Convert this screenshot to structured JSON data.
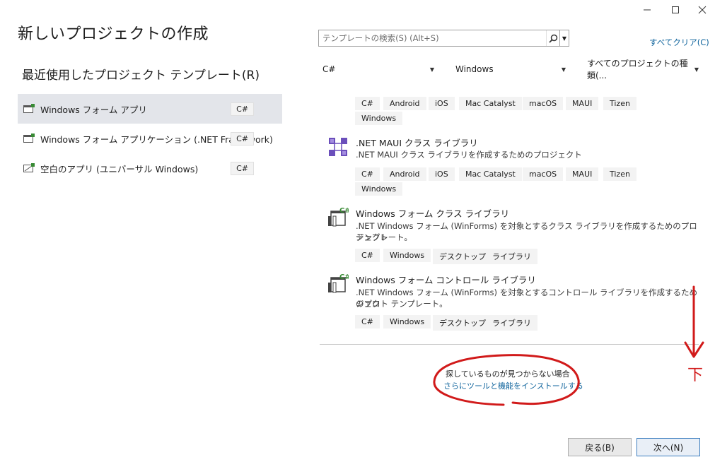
{
  "window": {
    "title": "新しいプロジェクトの作成",
    "controls": [
      "minimize-icon",
      "maximize-icon",
      "close-icon"
    ]
  },
  "recent": {
    "title": "最近使用したプロジェクト テンプレート(R)",
    "items": [
      {
        "label": "Windows フォーム アプリ",
        "lang": "C#",
        "icon": "winforms-app-icon",
        "selected": true
      },
      {
        "label": "Windows フォーム アプリケーション (.NET Framework)",
        "lang": "C#",
        "icon": "winforms-app-icon",
        "selected": false
      },
      {
        "label": "空白のアプリ (ユニバーサル Windows)",
        "lang": "C#",
        "icon": "uwp-app-icon",
        "selected": false
      }
    ]
  },
  "search": {
    "placeholder": "テンプレートの検索(S) (Alt+S)",
    "clear_all": "すべてクリア(C)"
  },
  "filters": {
    "language": "C#",
    "platform": "Windows",
    "project_type": "すべてのプロジェクトの種類(..."
  },
  "templates": [
    {
      "name": "",
      "desc": "",
      "tags": [
        "C#",
        "Android",
        "iOS",
        "Mac Catalyst",
        "macOS",
        "MAUI",
        "Tizen",
        "Windows"
      ]
    },
    {
      "name": ".NET MAUI クラス ライブラリ",
      "desc": ".NET MAUI クラス ライブラリを作成するためのプロジェクト",
      "icon": "maui-class-library-icon",
      "tags": [
        "C#",
        "Android",
        "iOS",
        "Mac Catalyst",
        "macOS",
        "MAUI",
        "Tizen",
        "Windows"
      ]
    },
    {
      "name": "Windows フォーム クラス ライブラリ",
      "desc_line1": ".NET Windows フォーム (WinForms) を対象とするクラス ライブラリを作成するためのプロジェクト",
      "desc_line2": "テンプレート。",
      "icon": "winforms-library-icon",
      "tags": [
        "C#",
        "Windows",
        "デスクトップ",
        "ライブラリ"
      ]
    },
    {
      "name": "Windows フォーム コントロール ライブラリ",
      "desc_line1": ".NET Windows フォーム (WinForms) を対象とするコントロール ライブラリを作成するためのプロ",
      "desc_line2": "ジェクト テンプレート。",
      "icon": "winforms-library-icon",
      "tags": [
        "C#",
        "Windows",
        "デスクトップ",
        "ライブラリ"
      ]
    }
  ],
  "not_found": {
    "text": "探しているものが見つからない場合",
    "link": "さらにツールと機能をインストールする"
  },
  "annotation": {
    "mark": "下",
    "color": "#d11a1a"
  },
  "buttons": {
    "back": "戻る(B)",
    "next": "次へ(N)"
  },
  "colors": {
    "link": "#0e639c",
    "selected_bg": "#e3e5ea",
    "tag_bg": "#f3f3f3",
    "maui_purple": "#6b4fbb",
    "csharp_green": "#388a34"
  }
}
